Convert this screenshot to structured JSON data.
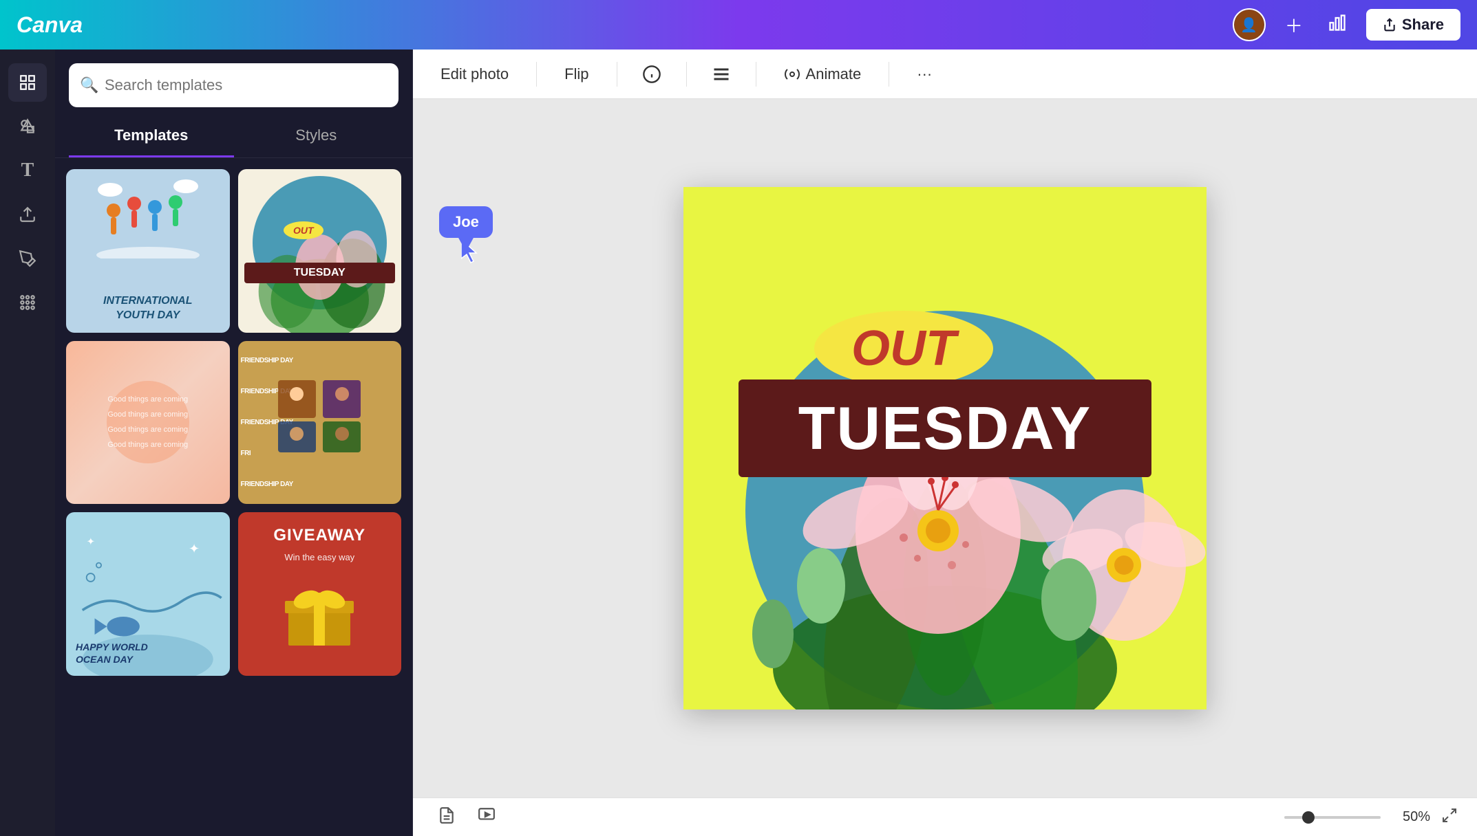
{
  "header": {
    "logo": "Canva",
    "share_label": "Share"
  },
  "toolbar": {
    "edit_photo": "Edit photo",
    "flip": "Flip",
    "animate": "Animate",
    "more": "···"
  },
  "left_panel": {
    "search_placeholder": "Search templates",
    "tab_templates": "Templates",
    "tab_styles": "Styles"
  },
  "templates": [
    {
      "id": "t1",
      "title": "International Youth Day",
      "bg": "#b8d4e8"
    },
    {
      "id": "t2",
      "title": "Tuesday Out",
      "bg": "#f5f0e0",
      "text_out": "OUT",
      "text_tuesday": "TUESDAY"
    },
    {
      "id": "t3",
      "title": "Good Things Are Coming",
      "lines": "Good things are coming"
    },
    {
      "id": "t4",
      "title": "Friendship Day",
      "text": "FRIENDSHIP DAY"
    },
    {
      "id": "t5",
      "title": "Happy World Ocean Day",
      "text": "HAPPY WORLD OCEAN DAY"
    },
    {
      "id": "t6",
      "title": "Giveaway",
      "text_main": "GIVEAWAY",
      "text_sub": "Win the easy way"
    }
  ],
  "canvas": {
    "text_out": "OUT",
    "text_tuesday": "TUESDAY"
  },
  "collaborator": {
    "name": "Joe"
  },
  "bottom_bar": {
    "zoom_value": "50",
    "zoom_label": "50%"
  },
  "sidebar_icons": [
    {
      "id": "grid-icon",
      "symbol": "⊞",
      "label": "Home"
    },
    {
      "id": "elements-icon",
      "symbol": "✦",
      "label": "Elements"
    },
    {
      "id": "text-icon",
      "symbol": "T",
      "label": "Text"
    },
    {
      "id": "uploads-icon",
      "symbol": "↑",
      "label": "Uploads"
    },
    {
      "id": "apps-icon",
      "symbol": "⋮⋮",
      "label": "Apps"
    }
  ]
}
